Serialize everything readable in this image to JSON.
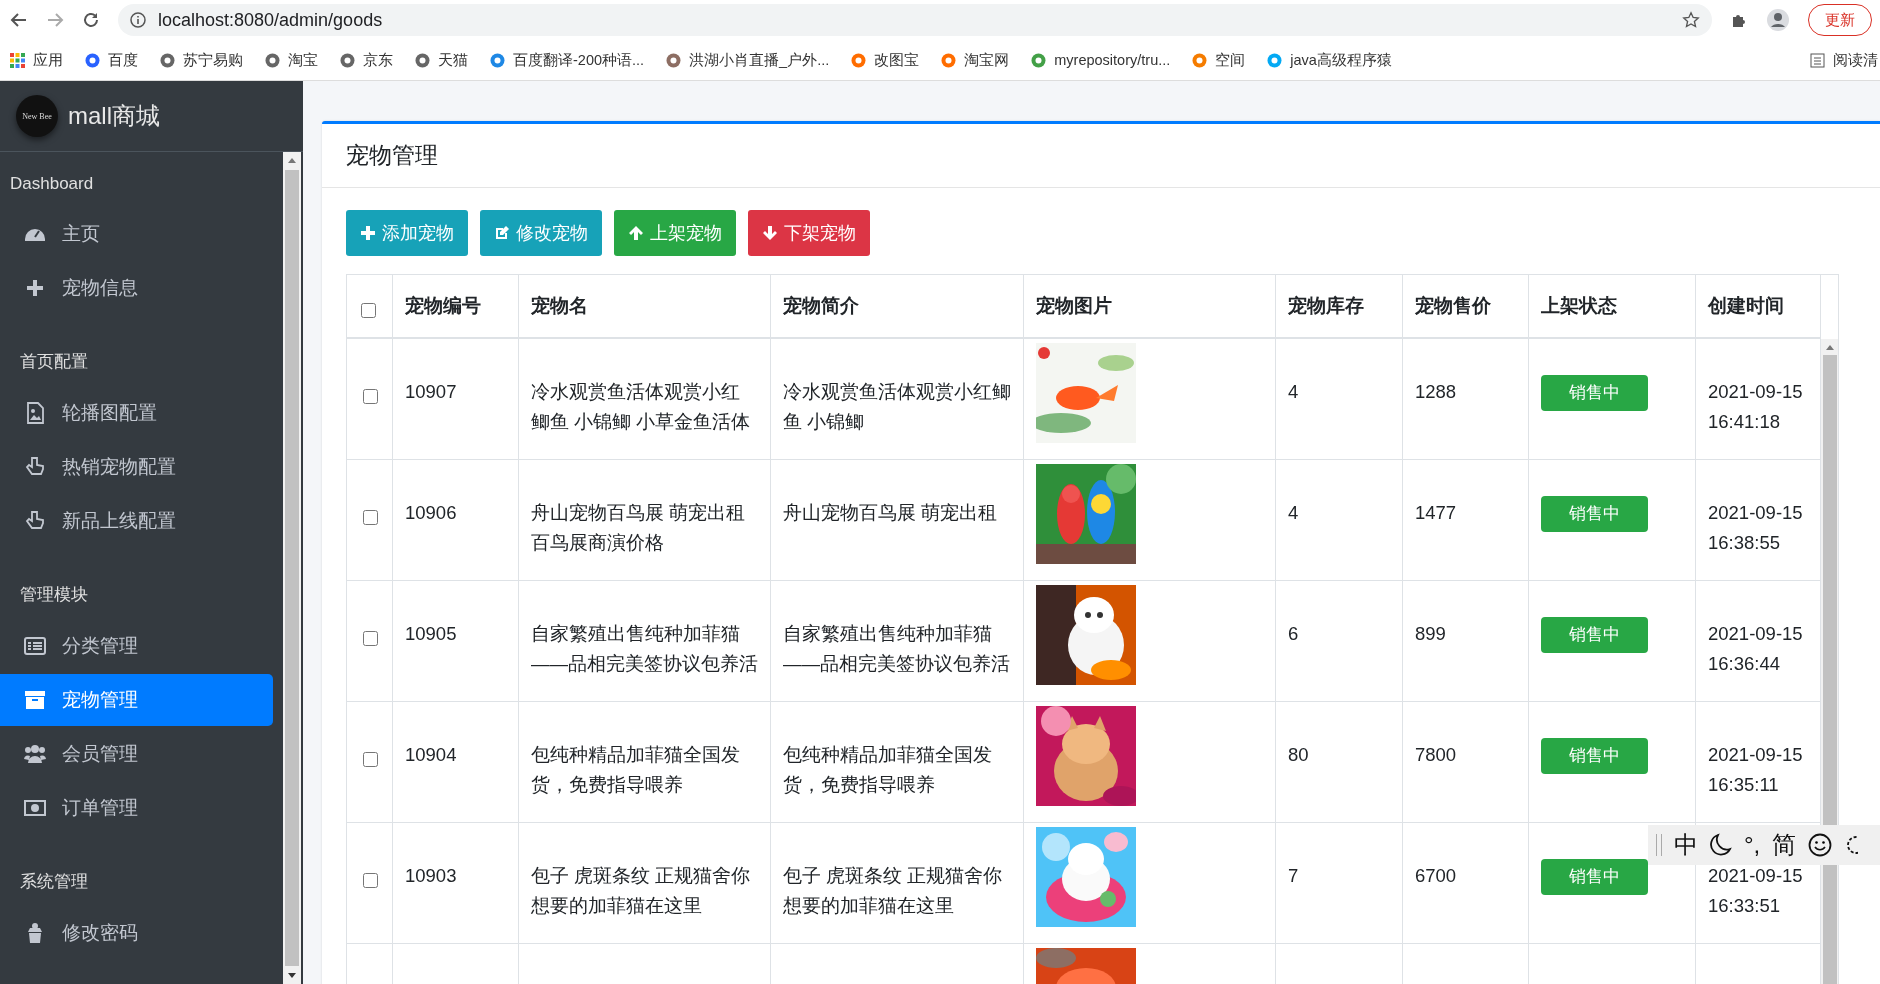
{
  "browser": {
    "url": "localhost:8080/admin/goods",
    "update_button": "更新",
    "bookmarks": [
      {
        "label": "应用"
      },
      {
        "label": "百度"
      },
      {
        "label": "苏宁易购"
      },
      {
        "label": "淘宝"
      },
      {
        "label": "京东"
      },
      {
        "label": "天猫"
      },
      {
        "label": "百度翻译-200种语..."
      },
      {
        "label": "洪湖小肖直播_户外..."
      },
      {
        "label": "改图宝"
      },
      {
        "label": "淘宝网"
      },
      {
        "label": "myrepository/tru..."
      },
      {
        "label": "空间"
      },
      {
        "label": "java高级程序猿"
      }
    ],
    "reading_list": "阅读清"
  },
  "sidebar": {
    "logo_text": "New Bee",
    "brand": "mall商城",
    "sections": [
      {
        "title": "Dashboard",
        "items": [
          {
            "label": "主页",
            "selected": false
          },
          {
            "label": "宠物信息",
            "selected": false
          }
        ]
      },
      {
        "title": "首页配置",
        "items": [
          {
            "label": "轮播图配置",
            "selected": false
          },
          {
            "label": "热销宠物配置",
            "selected": false
          },
          {
            "label": "新品上线配置",
            "selected": false
          }
        ]
      },
      {
        "title": "管理模块",
        "items": [
          {
            "label": "分类管理",
            "selected": false
          },
          {
            "label": "宠物管理",
            "selected": true
          },
          {
            "label": "会员管理",
            "selected": false
          },
          {
            "label": "订单管理",
            "selected": false
          }
        ]
      },
      {
        "title": "系统管理",
        "items": [
          {
            "label": "修改密码",
            "selected": false
          }
        ]
      }
    ]
  },
  "card": {
    "title": "宠物管理",
    "buttons": [
      {
        "label": "添加宠物",
        "kind": "add"
      },
      {
        "label": "修改宠物",
        "kind": "edit"
      },
      {
        "label": "上架宠物",
        "kind": "up"
      },
      {
        "label": "下架宠物",
        "kind": "down"
      }
    ],
    "table": {
      "select_all_checked": false,
      "columns": [
        "宠物编号",
        "宠物名",
        "宠物简介",
        "宠物图片",
        "宠物库存",
        "宠物售价",
        "上架状态",
        "创建时间"
      ],
      "rows": [
        {
          "checked": false,
          "id": "10907",
          "name": "冷水观赏鱼活体观赏小红鲫鱼 小锦鲫 小草金鱼活体",
          "intro": "冷水观赏鱼活体观赏小红鲫鱼 小锦鲫",
          "image": {
            "kind": "picture"
          },
          "stock": "4",
          "price": "1288",
          "status": "销售中",
          "date": "2021-09-15",
          "time": "16:41:18"
        },
        {
          "checked": false,
          "id": "10906",
          "name": "舟山宠物百鸟展 萌宠出租百鸟展商演价格",
          "intro": "舟山宠物百鸟展 萌宠出租",
          "image": {
            "kind": "picture"
          },
          "stock": "4",
          "price": "1477",
          "status": "销售中",
          "date": "2021-09-15",
          "time": "16:38:55"
        },
        {
          "checked": false,
          "id": "10905",
          "name": "自家繁殖出售纯种加菲猫——品相完美签协议包养活",
          "intro": "自家繁殖出售纯种加菲猫——品相完美签协议包养活",
          "image": {
            "kind": "picture"
          },
          "stock": "6",
          "price": "899",
          "status": "销售中",
          "date": "2021-09-15",
          "time": "16:36:44"
        },
        {
          "checked": false,
          "id": "10904",
          "name": "包纯种精品加菲猫全国发货，免费指导喂养",
          "intro": "包纯种精品加菲猫全国发货，免费指导喂养",
          "image": {
            "kind": "picture"
          },
          "stock": "80",
          "price": "7800",
          "status": "销售中",
          "date": "2021-09-15",
          "time": "16:35:11"
        },
        {
          "checked": false,
          "id": "10903",
          "name": "包子 虎斑条纹 正规猫舍你想要的加菲猫在这里",
          "intro": "包子 虎斑条纹 正规猫舍你想要的加菲猫在这里",
          "image": {
            "kind": "picture"
          },
          "stock": "7",
          "price": "6700",
          "status": "销售中",
          "date": "2021-09-15",
          "time": "16:33:51"
        },
        {
          "image": {
            "kind": "picture"
          }
        }
      ]
    }
  },
  "ime_toolbar": {
    "items": [
      "中",
      "°,",
      "简"
    ]
  }
}
